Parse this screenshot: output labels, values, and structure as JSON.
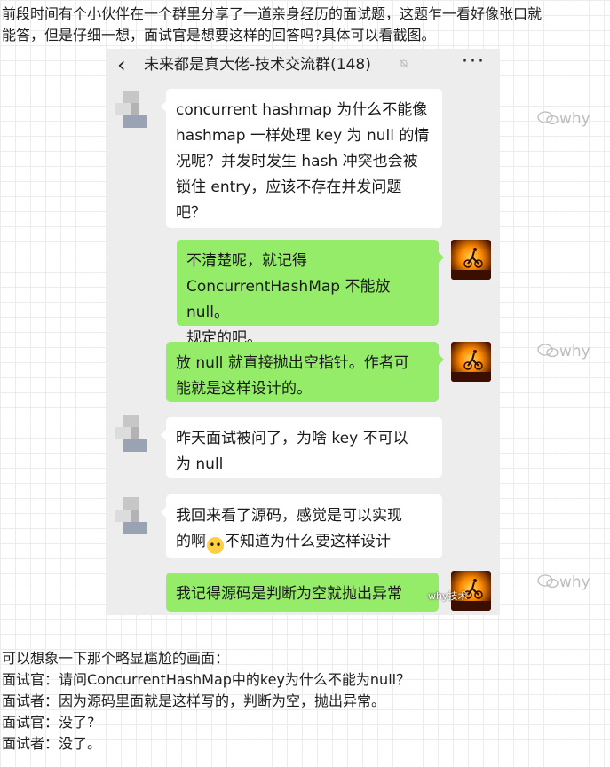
{
  "intro_line1": "前段时间有个小伙伴在一个群里分享了一道亲身经历的面试题，这题乍一看好像张口就",
  "intro_line2": "能答，但是仔细一想，面试官是想要这样的回答吗?具体可以看截图。",
  "chat": {
    "title": "未来都是真大佬-技术交流群(148)",
    "back_icon": "back-arrow-icon",
    "mute_icon": "bell-muted-icon",
    "more_icon": "more-dots-icon",
    "messages": [
      {
        "side": "left",
        "lines": [
          "concurrent hashmap 为什么不能像",
          "hashmap 一样处理 key 为 null 的情",
          "况呢？并发时发生 hash 冲突也会被",
          "锁住 entry，应该不存在并发问题",
          "吧？"
        ]
      },
      {
        "side": "right",
        "lines": [
          "不清楚呢，就记得",
          "ConcurrentHashMap 不能放 null。",
          "规定的吧。"
        ]
      },
      {
        "side": "right",
        "lines": [
          "放 null 就直接抛出空指针。作者可",
          "能就是这样设计的。"
        ]
      },
      {
        "side": "left",
        "lines": [
          "昨天面试被问了，为啥 key 不可以",
          "为 null"
        ]
      },
      {
        "side": "left",
        "line1": "我回来看了源码，感觉是可以实现",
        "line2_pre": "的啊",
        "line2_post": "不知道为什么要这样设计"
      },
      {
        "side": "right",
        "lines": [
          "我记得源码是判断为空就抛出异常"
        ]
      }
    ],
    "image_watermark": "why技术"
  },
  "watermark": "why",
  "watermark_icon": "wechat-icon",
  "outro": [
    "可以想象一下那个略显尴尬的画面：",
    "面试官：请问ConcurrentHashMap中的key为什么不能为null？",
    "面试者：因为源码里面就是这样写的，判断为空，抛出异常。",
    "面试官：没了?",
    "面试者：没了。"
  ],
  "colors": {
    "green_bubble": "#95ec69",
    "chat_bg": "#ededed",
    "white_bubble": "#ffffff"
  }
}
